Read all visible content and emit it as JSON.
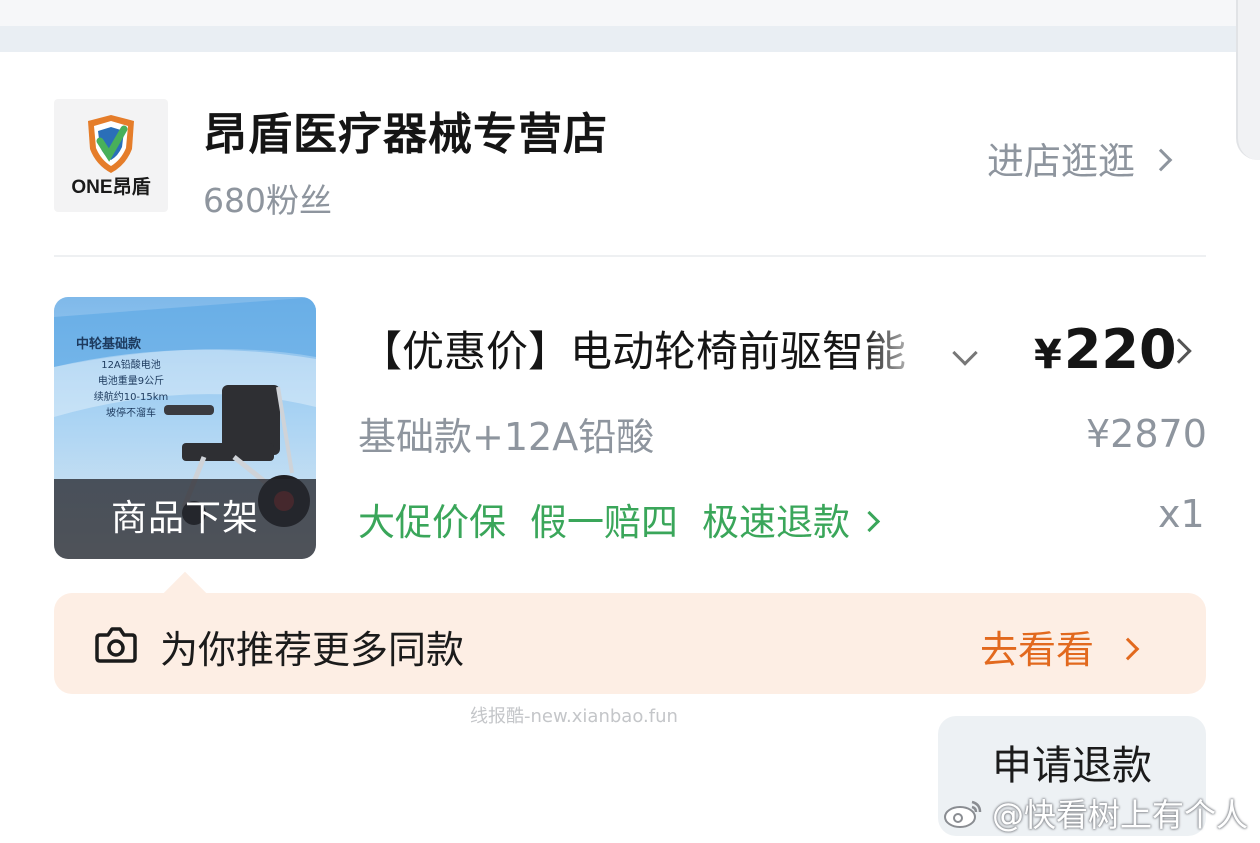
{
  "store": {
    "logo_text": "ONE昂盾",
    "name": "昂盾医疗器械专营店",
    "fans": "680粉丝",
    "visit_label": "进店逛逛"
  },
  "product": {
    "image_texts": {
      "headline": "中轮基础款",
      "lines": [
        "12A铅酸电池",
        "电池重量9公斤",
        "续航约10-15km",
        "坡停不溜车"
      ]
    },
    "status_overlay": "商品下架",
    "title": "【优惠价】电动轮椅前驱智能",
    "price_symbol": "¥",
    "price": "220",
    "spec": "基础款+12A铅酸",
    "original_price": "¥2870",
    "guarantees": [
      "大促价保",
      "假一赔四",
      "极速退款"
    ],
    "quantity": "x1"
  },
  "recommendation": {
    "text": "为你推荐更多同款",
    "action": "去看看"
  },
  "refund_button": "申请退款",
  "watermarks": {
    "site": "线报酷-new.xianbao.fun",
    "weibo": "@快看树上有个人"
  },
  "colors": {
    "green_tag": "#3aa65a",
    "orange_action": "#e2691e",
    "rec_bg": "#fdeee4",
    "muted_text": "#8e959e"
  }
}
